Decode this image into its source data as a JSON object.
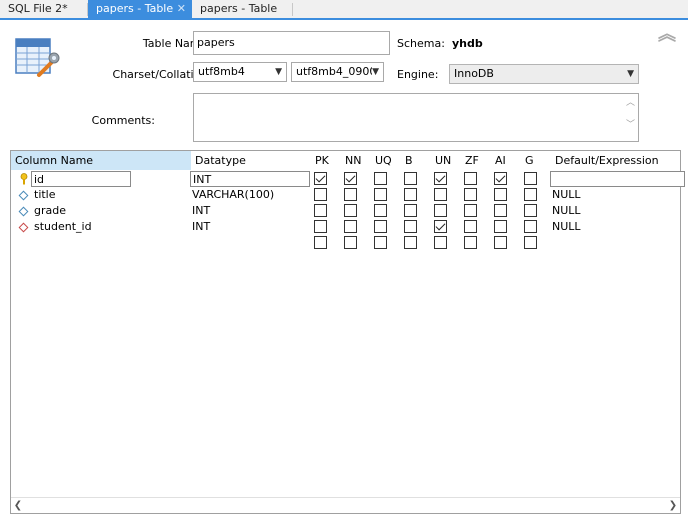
{
  "tabs": [
    {
      "label": "SQL File 2*",
      "active": false
    },
    {
      "label": "papers - Table",
      "active": true,
      "closable": true
    },
    {
      "label": "papers - Table",
      "active": false
    }
  ],
  "form": {
    "table_name_label": "Table Name:",
    "table_name_value": "papers",
    "schema_label": "Schema:",
    "schema_value": "yhdb",
    "charset_label": "Charset/Collation:",
    "charset_value": "utf8mb4",
    "collation_value": "utf8mb4_0900",
    "engine_label": "Engine:",
    "engine_value": "InnoDB",
    "comments_label": "Comments:",
    "comments_value": ""
  },
  "grid": {
    "headers": [
      "Column Name",
      "Datatype",
      "PK",
      "NN",
      "UQ",
      "B",
      "UN",
      "ZF",
      "AI",
      "G",
      "Default/Expression"
    ],
    "rows": [
      {
        "name": "id",
        "datatype": "INT",
        "icon": "primary-key-icon",
        "flags": [
          true,
          true,
          false,
          false,
          true,
          false,
          true,
          false
        ],
        "default": ""
      },
      {
        "name": "title",
        "datatype": "VARCHAR(100)",
        "icon": "column-icon",
        "flags": [
          false,
          false,
          false,
          false,
          false,
          false,
          false,
          false
        ],
        "default": "NULL"
      },
      {
        "name": "grade",
        "datatype": "INT",
        "icon": "column-icon",
        "flags": [
          false,
          false,
          false,
          false,
          false,
          false,
          false,
          false
        ],
        "default": "NULL"
      },
      {
        "name": "student_id",
        "datatype": "INT",
        "icon": "foreign-key-column-icon",
        "flags": [
          false,
          false,
          false,
          false,
          true,
          false,
          false,
          false
        ],
        "default": "NULL"
      },
      {
        "name": "",
        "datatype": "",
        "icon": "",
        "flags": [
          false,
          false,
          false,
          false,
          false,
          false,
          false,
          false
        ],
        "default": ""
      }
    ]
  },
  "colors": {
    "accent": "#3c8dde",
    "header_highlight": "#cde6f7"
  }
}
